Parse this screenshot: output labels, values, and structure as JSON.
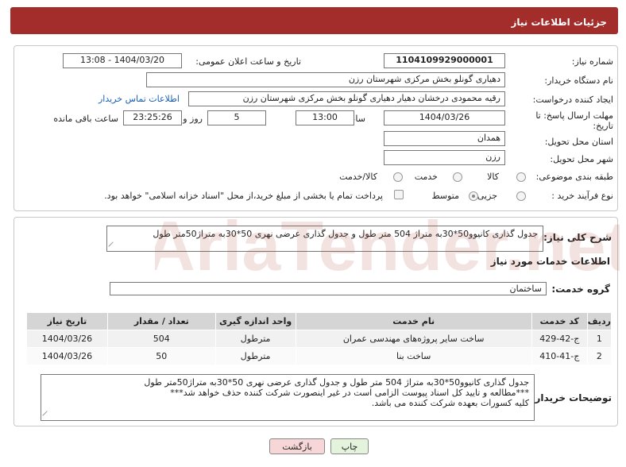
{
  "header": {
    "title": "جزئیات اطلاعات نیاز"
  },
  "fields": {
    "need_number_label": "شماره نیاز:",
    "need_number": "1104109929000001",
    "announce_label": "تاریخ و ساعت اعلان عمومی:",
    "announce_value": "1404/03/20 - 13:08",
    "buyer_org_label": "نام دستگاه خریدار:",
    "buyer_org": "دهیاری گونلو بخش مرکزی شهرستان رزن",
    "creator_label": "ایجاد کننده درخواست:",
    "creator": "رقیه محمودی درخشان دهیار دهیاری گونلو بخش مرکزی شهرستان رزن",
    "contact_link": "اطلاعات تماس خریدار",
    "deadline_label_1": "مهلت ارسال پاسخ: تا",
    "deadline_label_2": "تاریخ:",
    "deadline_date": "1404/03/26",
    "time_label": "ساعت",
    "deadline_time": "13:00",
    "days_value": "5",
    "days_label": "روز و",
    "remaining_time": "23:25:26",
    "remaining_label": "ساعت باقی مانده",
    "province_label": "استان محل تحویل:",
    "province": "همدان",
    "city_label": "شهر محل تحویل:",
    "city": "رزن",
    "category_label": "طبقه بندی موضوعی:",
    "category_options": [
      "کالا",
      "خدمت",
      "کالا/خدمت"
    ],
    "purchase_type_label": "نوع فرآیند خرید :",
    "purchase_type_options": [
      "جزیی",
      "متوسط"
    ],
    "payment_note": "پرداخت تمام یا بخشی از مبلغ خرید،از محل \"اسناد خزانه اسلامی\" خواهد بود."
  },
  "summary": {
    "label": "شرح کلی نیاز:",
    "text": "جدول گذاری کانیوو50*30به متراژ 504 متر طول و جدول گذاری عرضی نهری 50*30به متراژ50متر طول"
  },
  "services": {
    "section_title": "اطلاعات خدمات مورد نیاز",
    "group_label": "گروه خدمت:",
    "group_value": "ساختمان",
    "columns": [
      "ردیف",
      "کد خدمت",
      "نام خدمت",
      "واحد اندازه گیری",
      "تعداد / مقدار",
      "تاریخ نیاز"
    ],
    "rows": [
      [
        "1",
        "ج-42-429",
        "ساخت سایر پروژه‌های مهندسی عمران",
        "مترطول",
        "504",
        "1404/03/26"
      ],
      [
        "2",
        "ج-41-410",
        "ساخت بنا",
        "مترطول",
        "50",
        "1404/03/26"
      ]
    ]
  },
  "buyer_notes": {
    "label": "توضیحات خریدار:",
    "line1": "جدول گذاری کانیوو50*30به متراژ 504 متر طول و جدول گذاری عرضی نهری 50*30به متراژ50متر طول",
    "line2": "***مطالعه و تایید کل اسناد پیوست الزامی است در غیر اینصورت شرکت کننده حذف خواهد شد***",
    "line3": "کلیه کسورات بعهده شرکت کننده می باشد."
  },
  "buttons": {
    "print": "چاپ",
    "back": "بازگشت"
  },
  "watermark": {
    "text": "AriaTender.net"
  },
  "colors": {
    "header_bg": "#a32d2b",
    "link": "#1a5fb4",
    "back_btn_bg": "#f6d6d6",
    "print_btn_bg": "#e4f4dc"
  }
}
